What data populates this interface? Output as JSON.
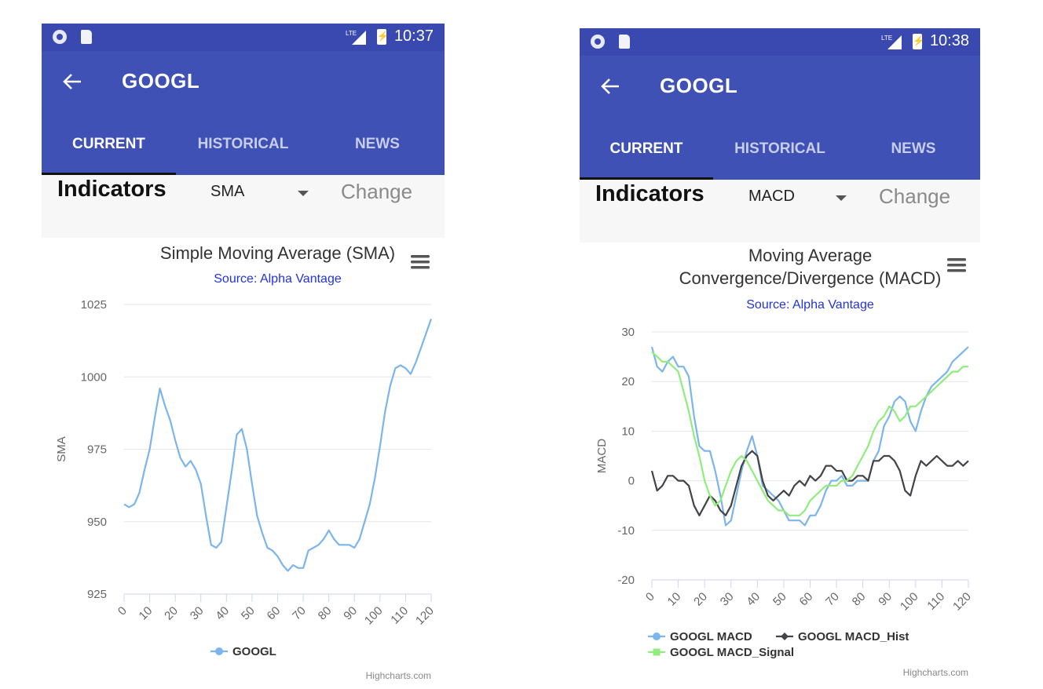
{
  "screens": [
    {
      "status": {
        "time": "10:37",
        "network_icon": "lte-signal-icon",
        "battery_icon": "battery-charging-icon"
      },
      "appbar": {
        "title": "GOOGL",
        "back_icon": "arrow-back-icon"
      },
      "tabs": [
        {
          "label": "CURRENT",
          "active": true
        },
        {
          "label": "HISTORICAL",
          "active": false
        },
        {
          "label": "NEWS",
          "active": false
        }
      ],
      "indicators": {
        "label": "Indicators",
        "selected": "SMA",
        "change_label": "Change"
      },
      "menu_icon": "hamburger-menu-icon",
      "colors": {
        "primary": "#3f51b5",
        "status": "#3a49b0"
      },
      "chart_data": {
        "type": "line",
        "title": "Simple Moving Average (SMA)",
        "subtitle": "Source: Alpha Vantage",
        "xlabel": "",
        "ylabel": "SMA",
        "xlim": [
          0,
          120
        ],
        "ylim": [
          925,
          1025
        ],
        "xticks": [
          0,
          10,
          20,
          30,
          40,
          50,
          60,
          70,
          80,
          90,
          100,
          110,
          120
        ],
        "yticks": [
          925,
          950,
          975,
          1000,
          1025
        ],
        "grid": true,
        "legend": "bottom-center",
        "credits": "Highcharts.com",
        "series": [
          {
            "name": "GOOGL",
            "color": "#7cb5ec",
            "marker": "circle",
            "x": [
              0,
              2,
              4,
              6,
              8,
              10,
              12,
              14,
              16,
              18,
              20,
              22,
              24,
              26,
              28,
              30,
              32,
              34,
              36,
              38,
              40,
              42,
              44,
              46,
              48,
              50,
              52,
              54,
              56,
              58,
              60,
              62,
              64,
              66,
              68,
              70,
              72,
              74,
              76,
              78,
              80,
              82,
              84,
              86,
              88,
              90,
              92,
              94,
              96,
              98,
              100,
              102,
              104,
              106,
              108,
              110,
              112,
              114,
              116,
              118,
              120
            ],
            "y": [
              956,
              955,
              956,
              960,
              968,
              975,
              986,
              996,
              990,
              985,
              978,
              972,
              969,
              971,
              968,
              963,
              952,
              942,
              941,
              943,
              955,
              967,
              980,
              982,
              975,
              963,
              952,
              946,
              941,
              940,
              938,
              935,
              933,
              935,
              934,
              934,
              940,
              941,
              942,
              944,
              947,
              944,
              942,
              942,
              942,
              941,
              944,
              950,
              956,
              965,
              976,
              988,
              997,
              1003,
              1004,
              1003,
              1001,
              1005,
              1010,
              1015,
              1020
            ]
          }
        ]
      }
    },
    {
      "status": {
        "time": "10:38",
        "network_icon": "lte-signal-icon",
        "battery_icon": "battery-charging-icon"
      },
      "appbar": {
        "title": "GOOGL",
        "back_icon": "arrow-back-icon"
      },
      "tabs": [
        {
          "label": "CURRENT",
          "active": true
        },
        {
          "label": "HISTORICAL",
          "active": false
        },
        {
          "label": "NEWS",
          "active": false
        }
      ],
      "indicators": {
        "label": "Indicators",
        "selected": "MACD",
        "change_label": "Change"
      },
      "menu_icon": "hamburger-menu-icon",
      "colors": {
        "primary": "#3f51b5",
        "status": "#3a49b0"
      },
      "chart_data": {
        "type": "line",
        "title": [
          "Moving Average",
          "Convergence/Divergence (MACD)"
        ],
        "subtitle": "Source: Alpha Vantage",
        "xlabel": "",
        "ylabel": "MACD",
        "xlim": [
          0,
          120
        ],
        "ylim": [
          -20,
          30
        ],
        "xticks": [
          0,
          10,
          20,
          30,
          40,
          50,
          60,
          70,
          80,
          90,
          100,
          110,
          120
        ],
        "yticks": [
          -20,
          -10,
          0,
          10,
          20,
          30
        ],
        "grid": true,
        "legend": "bottom-left",
        "credits": "Highcharts.com",
        "series": [
          {
            "name": "GOOGL MACD",
            "color": "#7cb5ec",
            "marker": "circle",
            "x": [
              0,
              2,
              4,
              6,
              8,
              10,
              12,
              14,
              16,
              18,
              20,
              22,
              24,
              26,
              28,
              30,
              32,
              34,
              36,
              38,
              40,
              42,
              44,
              46,
              48,
              50,
              52,
              54,
              56,
              58,
              60,
              62,
              64,
              66,
              68,
              70,
              72,
              74,
              76,
              78,
              80,
              82,
              84,
              86,
              88,
              90,
              92,
              94,
              96,
              98,
              100,
              102,
              104,
              106,
              108,
              110,
              112,
              114,
              116,
              118,
              120
            ],
            "y": [
              27,
              23,
              22,
              24,
              25,
              23,
              23,
              21,
              13,
              7,
              6,
              6,
              2,
              -3,
              -9,
              -8,
              -3,
              2,
              6,
              9,
              5,
              -1,
              -2,
              -3,
              -4,
              -6,
              -8,
              -8,
              -8,
              -9,
              -7,
              -7,
              -5,
              -2,
              0,
              0,
              1,
              -1,
              -1,
              0,
              0,
              0,
              4,
              6,
              11,
              13,
              16,
              17,
              16,
              12,
              10,
              14,
              17,
              19,
              20,
              21,
              22,
              24,
              25,
              26,
              27
            ]
          },
          {
            "name": "GOOGL MACD_Hist",
            "color": "#434348",
            "marker": "diamond",
            "x": [
              0,
              2,
              4,
              6,
              8,
              10,
              12,
              14,
              16,
              18,
              20,
              22,
              24,
              26,
              28,
              30,
              32,
              34,
              36,
              38,
              40,
              42,
              44,
              46,
              48,
              50,
              52,
              54,
              56,
              58,
              60,
              62,
              64,
              66,
              68,
              70,
              72,
              74,
              76,
              78,
              80,
              82,
              84,
              86,
              88,
              90,
              92,
              94,
              96,
              98,
              100,
              102,
              104,
              106,
              108,
              110,
              112,
              114,
              116,
              118,
              120
            ],
            "y": [
              2,
              -2,
              -1,
              1,
              1,
              0,
              0,
              -1,
              -5,
              -7,
              -5,
              -3,
              -4,
              -6,
              -7,
              -5,
              -1,
              3,
              5,
              6,
              5,
              0,
              -3,
              -4,
              -3,
              -2,
              -3,
              -1,
              0,
              -1,
              1,
              0,
              1,
              3,
              3,
              2,
              2,
              0,
              0,
              1,
              1,
              0,
              4,
              4,
              5,
              5,
              4,
              2,
              -2,
              -3,
              1,
              4,
              3,
              4,
              5,
              4,
              3,
              3,
              4,
              3,
              4
            ]
          },
          {
            "name": "GOOGL MACD_Signal",
            "color": "#90ed7d",
            "marker": "square",
            "x": [
              0,
              2,
              4,
              6,
              8,
              10,
              12,
              14,
              16,
              18,
              20,
              22,
              24,
              26,
              28,
              30,
              32,
              34,
              36,
              38,
              40,
              42,
              44,
              46,
              48,
              50,
              52,
              54,
              56,
              58,
              60,
              62,
              64,
              66,
              68,
              70,
              72,
              74,
              76,
              78,
              80,
              82,
              84,
              86,
              88,
              90,
              92,
              94,
              96,
              98,
              100,
              102,
              104,
              106,
              108,
              110,
              112,
              114,
              116,
              118,
              120
            ],
            "y": [
              26,
              25,
              24,
              24,
              23,
              22,
              18,
              14,
              9,
              5,
              0,
              -3,
              -5,
              -4,
              -1,
              2,
              4,
              5,
              4,
              2,
              0,
              -2,
              -4,
              -5,
              -6,
              -6,
              -7,
              -7,
              -7,
              -6,
              -4,
              -3,
              -2,
              -1,
              -1,
              -1,
              0,
              0,
              1,
              3,
              5,
              7,
              10,
              12,
              13,
              15,
              14,
              12,
              13,
              15,
              15,
              16,
              17,
              18,
              19,
              20,
              21,
              22,
              22,
              23,
              23
            ]
          }
        ]
      }
    }
  ]
}
